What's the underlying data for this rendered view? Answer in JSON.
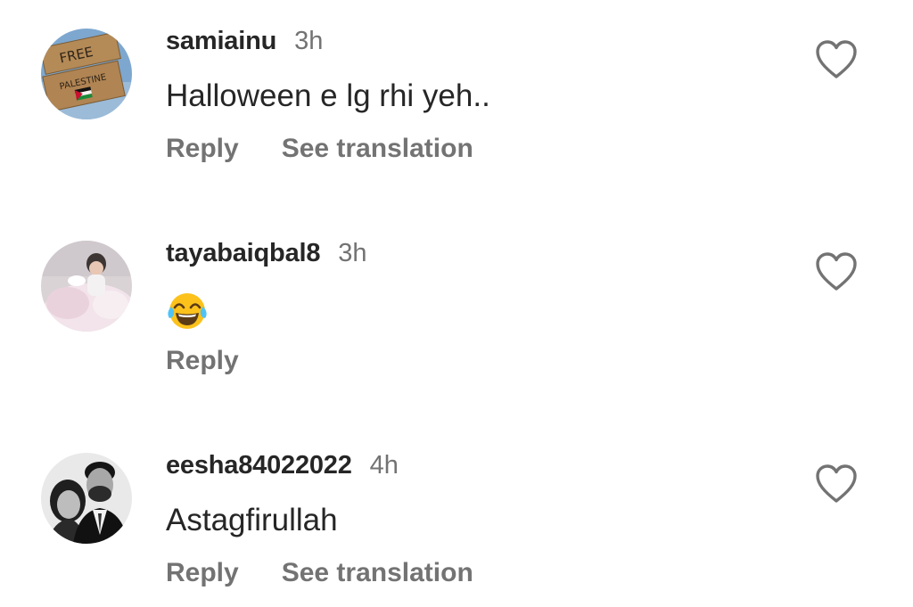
{
  "comments": [
    {
      "username": "samiainu",
      "time": "3h",
      "text": "Halloween e lg rhi yeh..",
      "reply_label": "Reply",
      "translate_label": "See translation",
      "avatar_sign_line1": "FREE",
      "avatar_sign_line2": "PALESTINE",
      "like_icon": "heart-outline-icon"
    },
    {
      "username": "tayabaiqbal8",
      "time": "3h",
      "emoji": "face-with-tears-of-joy",
      "reply_label": "Reply",
      "like_icon": "heart-outline-icon"
    },
    {
      "username": "eesha84022022",
      "time": "4h",
      "text": "Astagfirullah",
      "reply_label": "Reply",
      "translate_label": "See translation",
      "like_icon": "heart-outline-icon"
    }
  ],
  "colors": {
    "text_primary": "#262626",
    "text_secondary": "#737373",
    "icon": "#737373",
    "background": "#ffffff"
  }
}
